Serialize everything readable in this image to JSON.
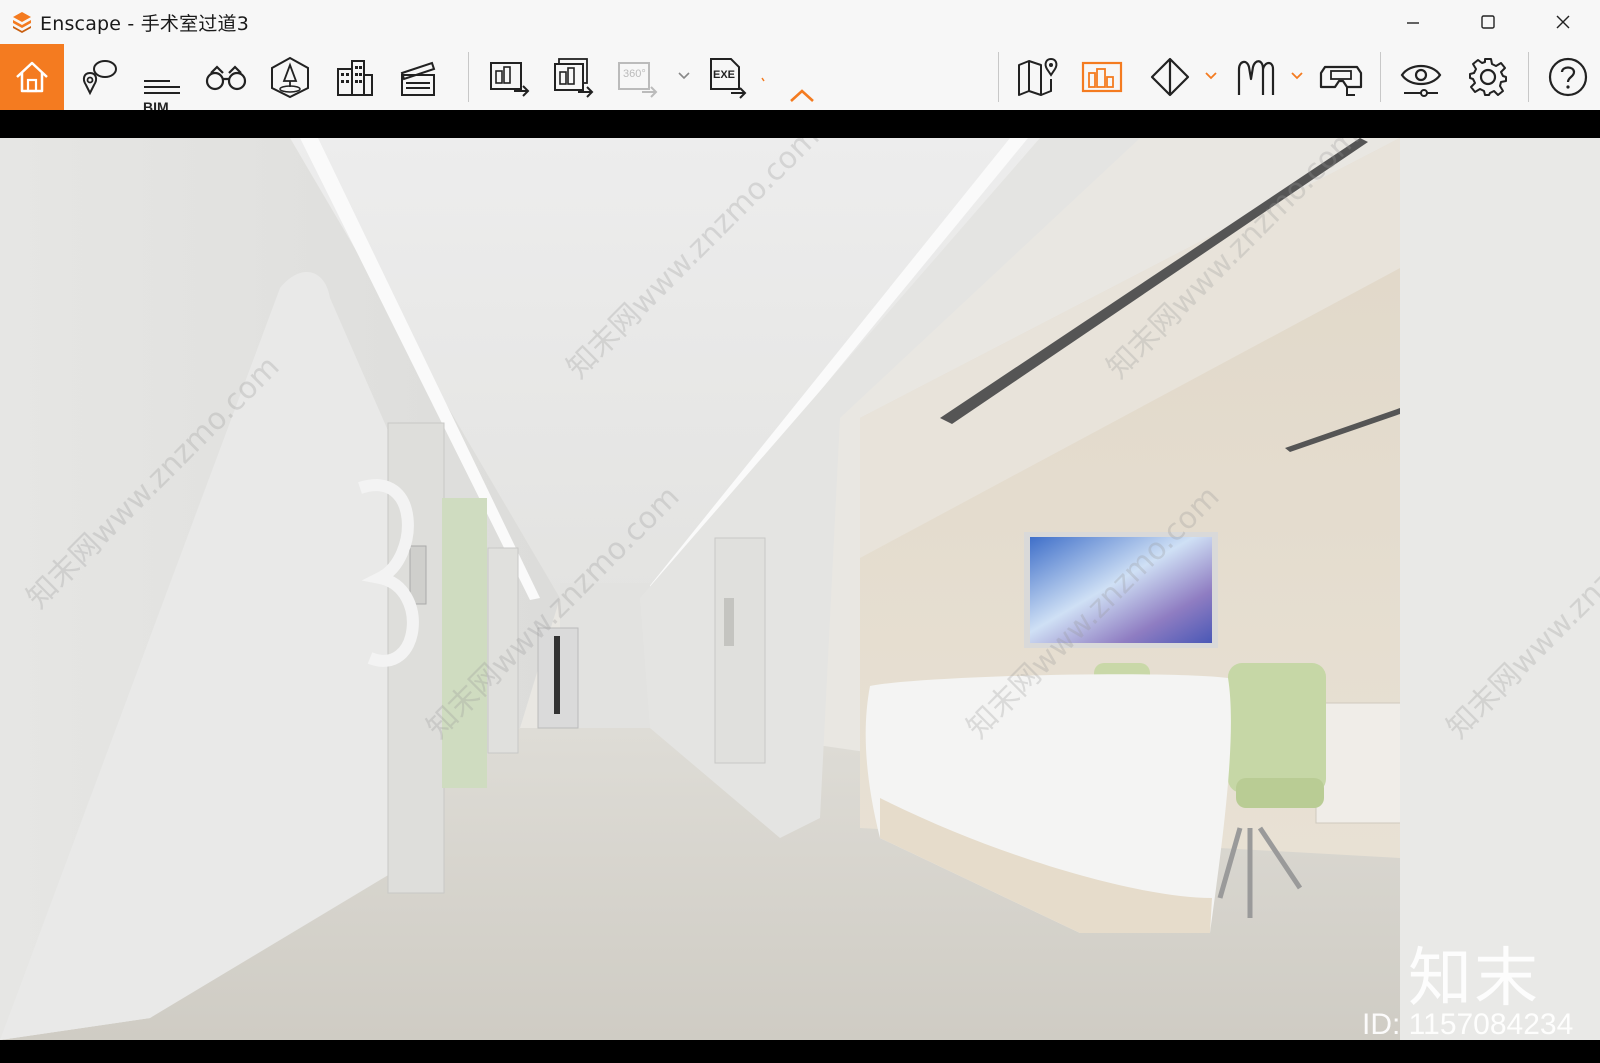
{
  "window": {
    "app_name": "Enscape",
    "title": "Enscape - 手术室过道3",
    "controls": [
      "minimize-icon",
      "maximize-icon",
      "close-icon"
    ]
  },
  "toolbar": {
    "accent_color": "#f47b20",
    "buttons": [
      {
        "name": "home-icon",
        "active": true
      },
      {
        "name": "views-icon"
      },
      {
        "name": "bim-icon",
        "label": "BIM"
      },
      {
        "name": "binoculars-icon"
      },
      {
        "name": "asset-library-icon"
      },
      {
        "name": "buildings-icon"
      },
      {
        "name": "video-editor-icon"
      },
      {
        "name": "export-image-icon"
      },
      {
        "name": "batch-export-icon"
      },
      {
        "name": "export-panorama-icon",
        "label": "360°",
        "disabled": true
      },
      {
        "name": "export-exe-icon",
        "label": "EXE"
      },
      {
        "name": "map-icon"
      },
      {
        "name": "view-presets-icon",
        "highlight": true
      },
      {
        "name": "cube-icon"
      },
      {
        "name": "fly-mode-icon"
      },
      {
        "name": "vr-headset-icon"
      },
      {
        "name": "visual-settings-icon"
      },
      {
        "name": "settings-gear-icon"
      },
      {
        "name": "help-icon"
      }
    ]
  },
  "viewport": {
    "watermark_big": "知末",
    "watermark_id": "ID: 1157084234",
    "watermark_diag": "知末网www.znzmo.com"
  }
}
